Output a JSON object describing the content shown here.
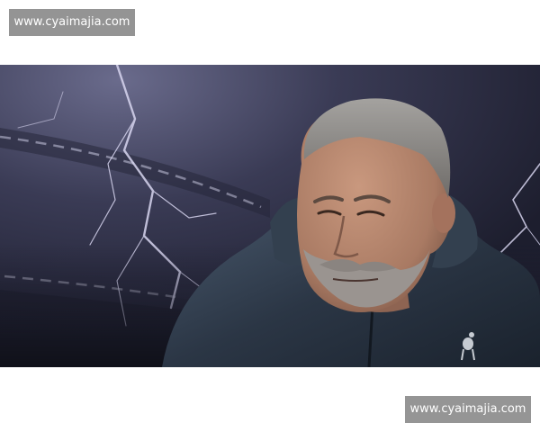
{
  "watermarks": {
    "top": "www.cyaimajia.com",
    "bottom": "www.cyaimajia.com"
  },
  "photo": {
    "subject": "man-in-dark-jacket",
    "background": "stormy-stadium-with-lightning",
    "palette": {
      "sky": "#3a3b55",
      "sky_dark": "#1d1e2e",
      "lightning": "#d8d6f0",
      "jacket": "#2b3645",
      "jacket_highlight": "#4a5a6e",
      "skin": "#b98a72",
      "skin_shadow": "#7e5848",
      "hair": "#8c8a88",
      "beard": "#9a9490"
    },
    "badge_icon": "cockerel-crest-icon"
  }
}
